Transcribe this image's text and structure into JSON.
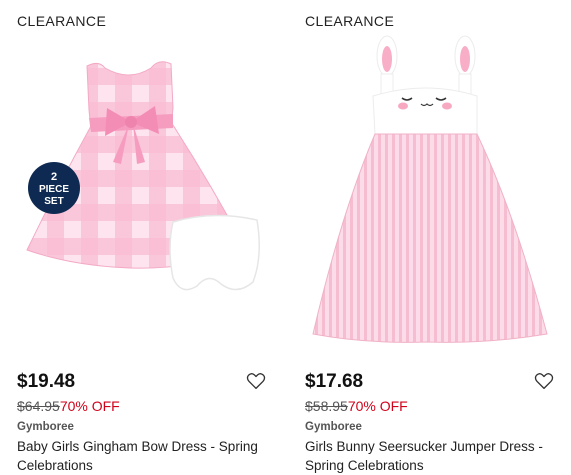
{
  "products": [
    {
      "badge": "CLEARANCE",
      "price": "$19.48",
      "original_price": "$64.95",
      "discount": "70% OFF",
      "brand": "Gymboree",
      "title": "Baby Girls Gingham Bow Dress - Spring Celebrations",
      "set_badge": [
        "2",
        "PIECE",
        "SET"
      ],
      "icon": "heart-outline"
    },
    {
      "badge": "CLEARANCE",
      "price": "$17.68",
      "original_price": "$58.95",
      "discount": "70% OFF",
      "brand": "Gymboree",
      "title": "Girls Bunny Seersucker Jumper Dress - Spring Celebrations",
      "icon": "heart-outline"
    }
  ],
  "colors": {
    "discount": "#d0021b",
    "dress_pink": "#f7b9cf",
    "badge_navy": "#0f2a52"
  }
}
